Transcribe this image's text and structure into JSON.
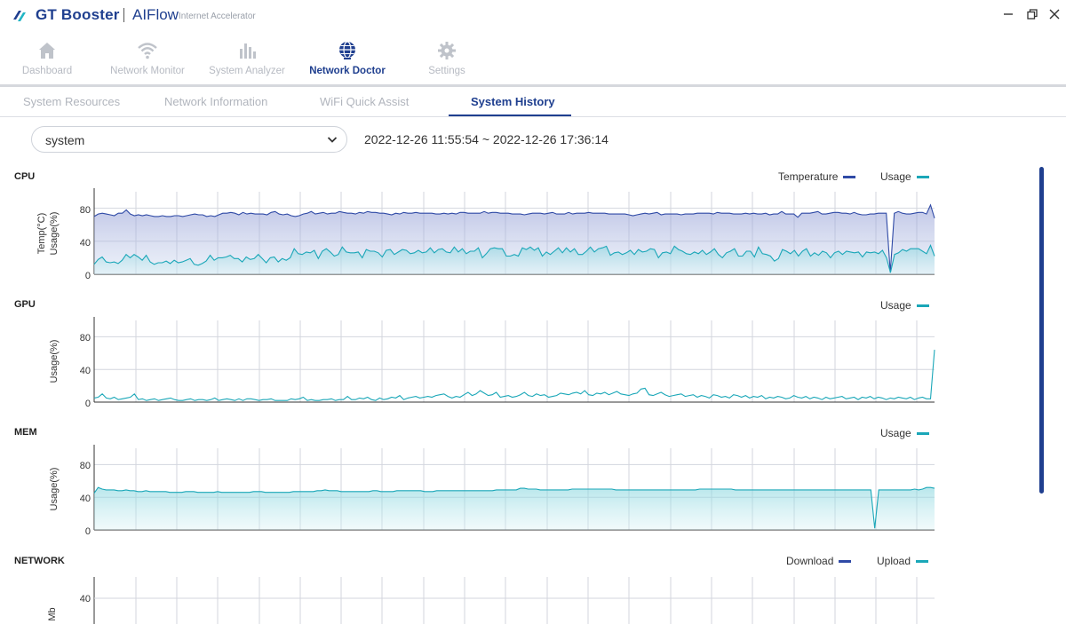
{
  "app": {
    "brand_primary": "GT Booster",
    "brand_secondary": "AIFlow",
    "brand_tagline": "Internet Accelerator",
    "window_controls": [
      "minimize",
      "restore",
      "close"
    ]
  },
  "nav": {
    "items": [
      {
        "label": "Dashboard",
        "icon": "home-icon"
      },
      {
        "label": "Network Monitor",
        "icon": "wifi-icon"
      },
      {
        "label": "System Analyzer",
        "icon": "bar-chart-icon"
      },
      {
        "label": "Network Doctor",
        "icon": "globe-icon",
        "active": true
      },
      {
        "label": "Settings",
        "icon": "gear-icon"
      }
    ]
  },
  "subtabs": {
    "items": [
      {
        "label": "System Resources"
      },
      {
        "label": "Network Information"
      },
      {
        "label": "WiFi Quick Assist"
      },
      {
        "label": "System History",
        "active": true
      }
    ]
  },
  "filter": {
    "selected": "system",
    "date_range": "2022-12-26 11:55:54 ~ 2022-12-26 17:36:14"
  },
  "colors": {
    "accent": "#1f3f8f",
    "temperature": "#2f4aa6",
    "usage": "#1aa7b8",
    "grid": "#c8ccd6"
  },
  "sections": {
    "cpu": {
      "label": "CPU",
      "y_label_1": "Temp(°C)",
      "y_label_2": "Usage(%)",
      "legend_temp": "Temperature",
      "legend_usage": "Usage",
      "ticks": [
        "80",
        "40",
        "0"
      ]
    },
    "gpu": {
      "label": "GPU",
      "y_label": "Usage(%)",
      "legend_usage": "Usage",
      "ticks": [
        "80",
        "40",
        "0"
      ]
    },
    "mem": {
      "label": "MEM",
      "y_label": "Usage(%)",
      "legend_usage": "Usage",
      "ticks": [
        "80",
        "40",
        "0"
      ]
    },
    "network": {
      "label": "NETWORK",
      "y_label": "Mb",
      "legend_download": "Download",
      "legend_upload": "Upload",
      "ticks": [
        "40"
      ]
    }
  },
  "chart_data": [
    {
      "type": "line",
      "title": "CPU",
      "ylim": [
        0,
        100
      ],
      "series": [
        {
          "name": "Temperature",
          "values": [
            70,
            73,
            74,
            73,
            72,
            71,
            74,
            74,
            78,
            73,
            71,
            72,
            71,
            72,
            71,
            70,
            70,
            71,
            70,
            70,
            71,
            71,
            70,
            71,
            72,
            73,
            72,
            72,
            70,
            71,
            70,
            72,
            74,
            74,
            75,
            74,
            72,
            75,
            73,
            74,
            73,
            73,
            73,
            72,
            75,
            76,
            73,
            72,
            73,
            71,
            70,
            71,
            73,
            74,
            76,
            73,
            74,
            75,
            73,
            74,
            74,
            76,
            75,
            74,
            74,
            73,
            75,
            74,
            76,
            75,
            75,
            74,
            74,
            73,
            72,
            74,
            73,
            75,
            74,
            74,
            75,
            74,
            74,
            74,
            74,
            73,
            73,
            74,
            73,
            74,
            73,
            75,
            75,
            74,
            74,
            74,
            74,
            76,
            74,
            75,
            75,
            74,
            74,
            74,
            73,
            73,
            73,
            72,
            73,
            74,
            74,
            74,
            73,
            74,
            75,
            73,
            73,
            73,
            75,
            73,
            74,
            74,
            74,
            75,
            74,
            74,
            74,
            74,
            73,
            73,
            73,
            73,
            73,
            72,
            71,
            72,
            73,
            74,
            73,
            74,
            75,
            72,
            73,
            73,
            73,
            73,
            72,
            73,
            73,
            73,
            74,
            74,
            74,
            74,
            73,
            75,
            74,
            74,
            74,
            73,
            73,
            73,
            74,
            73,
            74,
            73,
            73,
            74,
            72,
            73,
            73,
            76,
            73,
            73,
            73,
            69,
            74,
            74,
            74,
            75,
            76,
            73,
            73,
            74,
            75,
            75,
            74,
            74,
            73,
            75,
            73,
            72,
            72,
            73,
            73,
            74,
            74,
            74,
            2,
            74,
            76,
            74,
            73,
            73,
            74,
            75,
            75,
            73,
            84,
            68
          ]
        },
        {
          "name": "Usage",
          "values": [
            12,
            18,
            21,
            15,
            14,
            15,
            13,
            17,
            24,
            20,
            24,
            21,
            17,
            23,
            15,
            12,
            14,
            14,
            16,
            13,
            17,
            14,
            15,
            17,
            19,
            12,
            11,
            13,
            16,
            23,
            17,
            20,
            20,
            21,
            23,
            19,
            19,
            15,
            21,
            18,
            19,
            24,
            19,
            14,
            20,
            21,
            15,
            19,
            17,
            20,
            31,
            25,
            24,
            27,
            26,
            29,
            19,
            28,
            31,
            27,
            22,
            24,
            33,
            27,
            26,
            26,
            27,
            20,
            30,
            28,
            28,
            26,
            21,
            29,
            30,
            24,
            27,
            30,
            29,
            25,
            26,
            29,
            26,
            27,
            32,
            26,
            30,
            31,
            27,
            26,
            33,
            27,
            31,
            25,
            28,
            28,
            32,
            20,
            25,
            31,
            32,
            31,
            31,
            22,
            22,
            24,
            22,
            32,
            30,
            33,
            29,
            32,
            22,
            27,
            24,
            28,
            32,
            26,
            32,
            27,
            31,
            24,
            24,
            28,
            33,
            27,
            31,
            32,
            34,
            23,
            26,
            27,
            24,
            26,
            29,
            24,
            30,
            27,
            28,
            31,
            30,
            20,
            26,
            27,
            25,
            34,
            30,
            28,
            25,
            24,
            27,
            25,
            29,
            24,
            27,
            31,
            24,
            20,
            26,
            28,
            31,
            22,
            22,
            28,
            28,
            21,
            33,
            25,
            24,
            22,
            16,
            19,
            30,
            28,
            25,
            29,
            22,
            28,
            31,
            22,
            26,
            23,
            28,
            26,
            20,
            26,
            28,
            24,
            28,
            27,
            26,
            27,
            21,
            27,
            26,
            27,
            25,
            29,
            20,
            2,
            24,
            26,
            30,
            28,
            31,
            31,
            31,
            28,
            25,
            35,
            22
          ]
        }
      ]
    },
    {
      "type": "line",
      "title": "GPU",
      "ylim": [
        0,
        100
      ],
      "series": [
        {
          "name": "Usage",
          "values": [
            5,
            6,
            10,
            5,
            4,
            6,
            3,
            4,
            5,
            6,
            10,
            3,
            4,
            2,
            3,
            4,
            2,
            3,
            4,
            5,
            3,
            2,
            2,
            3,
            4,
            2,
            3,
            3,
            2,
            3,
            5,
            2,
            3,
            4,
            3,
            2,
            4,
            2,
            4,
            4,
            3,
            2,
            3,
            3,
            4,
            2,
            2,
            2,
            2,
            4,
            3,
            4,
            6,
            2,
            3,
            2,
            2,
            3,
            3,
            4,
            2,
            3,
            3,
            7,
            3,
            3,
            5,
            4,
            6,
            3,
            2,
            5,
            3,
            4,
            6,
            5,
            8,
            3,
            5,
            6,
            7,
            5,
            6,
            7,
            6,
            8,
            9,
            10,
            7,
            5,
            7,
            6,
            9,
            12,
            8,
            10,
            14,
            11,
            8,
            9,
            12,
            6,
            7,
            8,
            6,
            7,
            9,
            12,
            8,
            7,
            10,
            8,
            9,
            6,
            7,
            8,
            11,
            10,
            9,
            11,
            12,
            10,
            14,
            9,
            8,
            11,
            10,
            12,
            9,
            11,
            13,
            10,
            9,
            8,
            10,
            11,
            16,
            17,
            9,
            8,
            10,
            12,
            9,
            7,
            8,
            9,
            10,
            7,
            8,
            9,
            6,
            8,
            7,
            5,
            9,
            8,
            6,
            7,
            5,
            9,
            8,
            6,
            8,
            5,
            7,
            6,
            8,
            4,
            6,
            5,
            7,
            6,
            4,
            5,
            8,
            6,
            5,
            7,
            4,
            6,
            5,
            3,
            6,
            4,
            5,
            6,
            7,
            4,
            5,
            6,
            3,
            6,
            5,
            7,
            4,
            6,
            5,
            3,
            5,
            4,
            6,
            5,
            4,
            6,
            3,
            5,
            6,
            4,
            4,
            64
          ]
        }
      ]
    },
    {
      "type": "area",
      "title": "MEM",
      "ylim": [
        0,
        100
      ],
      "series": [
        {
          "name": "Usage",
          "values": [
            45,
            52,
            50,
            49,
            49,
            49,
            48,
            48,
            49,
            48,
            48,
            47,
            47,
            48,
            47,
            47,
            47,
            47,
            47,
            46,
            46,
            46,
            46,
            47,
            47,
            47,
            46,
            46,
            46,
            46,
            46,
            47,
            46,
            46,
            46,
            46,
            46,
            46,
            46,
            46,
            47,
            47,
            47,
            46,
            46,
            46,
            46,
            46,
            46,
            46,
            47,
            47,
            47,
            47,
            47,
            47,
            48,
            48,
            49,
            48,
            48,
            48,
            47,
            47,
            47,
            47,
            47,
            47,
            47,
            47,
            48,
            48,
            47,
            47,
            47,
            47,
            48,
            48,
            48,
            48,
            48,
            48,
            48,
            47,
            47,
            47,
            48,
            48,
            48,
            48,
            48,
            48,
            48,
            48,
            48,
            48,
            48,
            48,
            48,
            48,
            48,
            49,
            49,
            49,
            49,
            49,
            49,
            51,
            51,
            50,
            50,
            50,
            49,
            49,
            49,
            49,
            49,
            49,
            49,
            49,
            50,
            50,
            50,
            50,
            50,
            50,
            50,
            50,
            50,
            50,
            50,
            49,
            49,
            49,
            49,
            49,
            49,
            49,
            49,
            49,
            49,
            49,
            49,
            49,
            49,
            49,
            49,
            49,
            49,
            49,
            49,
            49,
            50,
            50,
            50,
            50,
            50,
            50,
            50,
            50,
            50,
            49,
            49,
            49,
            49,
            49,
            49,
            49,
            49,
            49,
            49,
            49,
            49,
            49,
            49,
            49,
            49,
            49,
            49,
            49,
            49,
            49,
            49,
            49,
            49,
            49,
            49,
            49,
            49,
            49,
            49,
            49,
            49,
            49,
            49,
            49,
            2,
            49,
            49,
            49,
            49,
            49,
            49,
            49,
            49,
            49,
            50,
            49,
            50,
            52,
            52,
            51
          ]
        }
      ]
    },
    {
      "type": "line",
      "title": "NETWORK",
      "ylabel": "Mb",
      "series": [
        {
          "name": "Download",
          "values": []
        },
        {
          "name": "Upload",
          "values": []
        }
      ]
    }
  ]
}
